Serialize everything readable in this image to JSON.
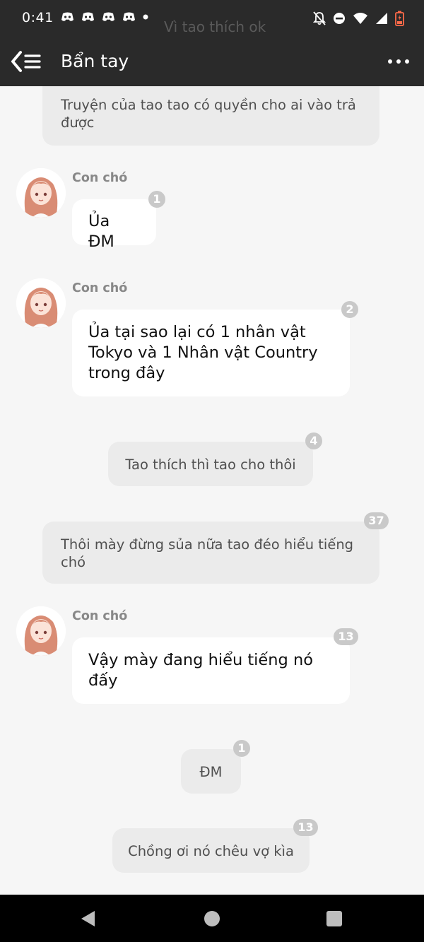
{
  "status_bar": {
    "time": "0:41",
    "left_icons": [
      "discord-icon",
      "discord-icon",
      "discord-icon",
      "discord-icon",
      "notification-dot"
    ],
    "right_icons": [
      "notifications-off-icon",
      "do-not-disturb-icon",
      "wifi-icon",
      "signal-icon",
      "battery-low-icon"
    ],
    "ghost_text": "Vì tao thích ok"
  },
  "app_bar": {
    "title": "Bẩn tay",
    "back_icon": "back-chapter-list-icon",
    "more_icon": "more-horizontal-icon"
  },
  "messages": [
    {
      "type": "narration",
      "text": "Truyện của tao tao có quyền cho ai vào trả được",
      "badge": ""
    },
    {
      "type": "character",
      "name": "Con chó",
      "text": "Ủa ĐM",
      "badge": "1"
    },
    {
      "type": "character",
      "name": "Con chó",
      "text": "Ủa tại sao lại có 1 nhân vật Tokyo và 1 Nhân vật Country trong đây",
      "badge": "2"
    },
    {
      "type": "narration",
      "text": "Tao thích thì tao cho thôi",
      "badge": "4"
    },
    {
      "type": "narration",
      "text": "Thôi mày đừng sủa nữa tao đéo hiểu tiếng chó",
      "badge": "37"
    },
    {
      "type": "character",
      "name": "Con chó",
      "text": "Vậy mày đang hiểu tiếng nó đấy",
      "badge": "13"
    },
    {
      "type": "narration",
      "text": "ĐM",
      "badge": "1"
    },
    {
      "type": "narration",
      "text": "Chồng ơi nó chêu vợ kìa",
      "badge": "13"
    }
  ],
  "colors": {
    "bar_bg": "#2a2a2a",
    "chat_bg": "#f6f6f6",
    "narration_bubble": "#ebebeb",
    "character_bubble": "#ffffff",
    "badge_bg": "#c9c9c9"
  },
  "nav_bar": {
    "buttons": [
      "back-triangle-icon",
      "home-circle-icon",
      "recents-square-icon"
    ]
  }
}
